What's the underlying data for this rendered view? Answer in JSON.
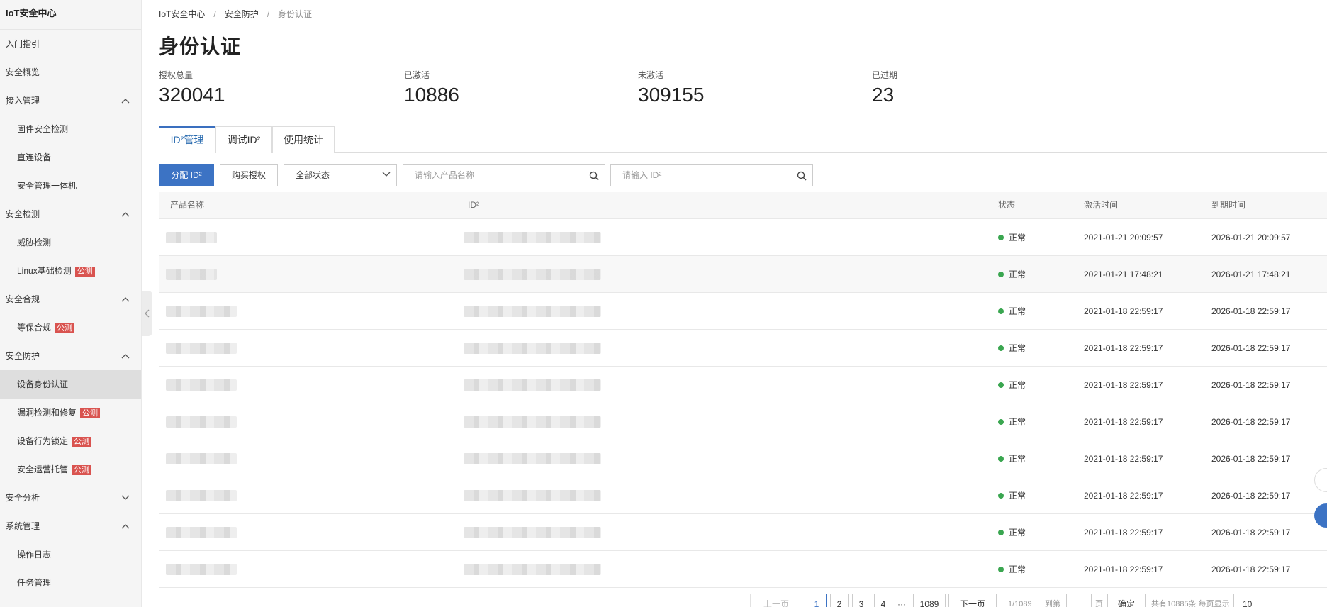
{
  "app": {
    "title": "IoT安全中心"
  },
  "sidebar": {
    "items": [
      {
        "label": "入门指引",
        "type": "single"
      },
      {
        "label": "安全概览",
        "type": "single"
      },
      {
        "label": "接入管理",
        "type": "group",
        "expanded": true
      },
      {
        "label": "固件安全检测",
        "type": "child"
      },
      {
        "label": "直连设备",
        "type": "child"
      },
      {
        "label": "安全管理一体机",
        "type": "child"
      },
      {
        "label": "安全检测",
        "type": "group",
        "expanded": true
      },
      {
        "label": "威胁检测",
        "type": "child"
      },
      {
        "label": "Linux基础检测",
        "type": "child",
        "badge": "公测"
      },
      {
        "label": "安全合规",
        "type": "group",
        "expanded": true
      },
      {
        "label": "等保合规",
        "type": "child",
        "badge": "公测"
      },
      {
        "label": "安全防护",
        "type": "group",
        "expanded": true
      },
      {
        "label": "设备身份认证",
        "type": "child",
        "active": true
      },
      {
        "label": "漏洞检测和修复",
        "type": "child",
        "badge": "公测"
      },
      {
        "label": "设备行为锁定",
        "type": "child",
        "badge": "公测"
      },
      {
        "label": "安全运营托管",
        "type": "child",
        "badge": "公测"
      },
      {
        "label": "安全分析",
        "type": "group",
        "expanded": false
      },
      {
        "label": "系统管理",
        "type": "group",
        "expanded": true
      },
      {
        "label": "操作日志",
        "type": "child"
      },
      {
        "label": "任务管理",
        "type": "child"
      }
    ]
  },
  "breadcrumb": {
    "items": [
      "IoT安全中心",
      "安全防护",
      "身份认证"
    ],
    "separator": "/"
  },
  "page": {
    "title": "身份认证"
  },
  "stats": [
    {
      "label": "授权总量",
      "value": "320041"
    },
    {
      "label": "已激活",
      "value": "10886"
    },
    {
      "label": "未激活",
      "value": "309155"
    },
    {
      "label": "已过期",
      "value": "23"
    }
  ],
  "tabs": [
    {
      "label": "ID²管理",
      "active": true
    },
    {
      "label": "调试ID²",
      "active": false
    },
    {
      "label": "使用统计",
      "active": false
    }
  ],
  "toolbar": {
    "assign_label": "分配 ID²",
    "buy_label": "购买授权",
    "status_select": "全部状态",
    "product_placeholder": "请输入产品名称",
    "id_placeholder": "请输入 ID²"
  },
  "table": {
    "columns": [
      "产品名称",
      "ID²",
      "状态",
      "激活时间",
      "到期时间"
    ],
    "rows": [
      {
        "status": "正常",
        "activated": "2021-01-21 20:09:57",
        "expires": "2026-01-21 20:09:57"
      },
      {
        "status": "正常",
        "activated": "2021-01-21 17:48:21",
        "expires": "2026-01-21 17:48:21"
      },
      {
        "status": "正常",
        "activated": "2021-01-18 22:59:17",
        "expires": "2026-01-18 22:59:17"
      },
      {
        "status": "正常",
        "activated": "2021-01-18 22:59:17",
        "expires": "2026-01-18 22:59:17"
      },
      {
        "status": "正常",
        "activated": "2021-01-18 22:59:17",
        "expires": "2026-01-18 22:59:17"
      },
      {
        "status": "正常",
        "activated": "2021-01-18 22:59:17",
        "expires": "2026-01-18 22:59:17"
      },
      {
        "status": "正常",
        "activated": "2021-01-18 22:59:17",
        "expires": "2026-01-18 22:59:17"
      },
      {
        "status": "正常",
        "activated": "2021-01-18 22:59:17",
        "expires": "2026-01-18 22:59:17"
      },
      {
        "status": "正常",
        "activated": "2021-01-18 22:59:17",
        "expires": "2026-01-18 22:59:17"
      },
      {
        "status": "正常",
        "activated": "2021-01-18 22:59:17",
        "expires": "2026-01-18 22:59:17"
      }
    ]
  },
  "pagination": {
    "prev": "上一页",
    "pages": [
      "1",
      "2",
      "3",
      "4"
    ],
    "ellipsis": "···",
    "last": "1089",
    "next": "下一页",
    "current_of_total": "1/1089",
    "goto_label": "到第",
    "page_unit": "页",
    "confirm": "确定",
    "summary": "共有10885条 每页显示",
    "page_size": "10"
  },
  "colors": {
    "primary": "#3c73c4",
    "status_ok": "#3aa650",
    "badge": "#d9534f"
  }
}
